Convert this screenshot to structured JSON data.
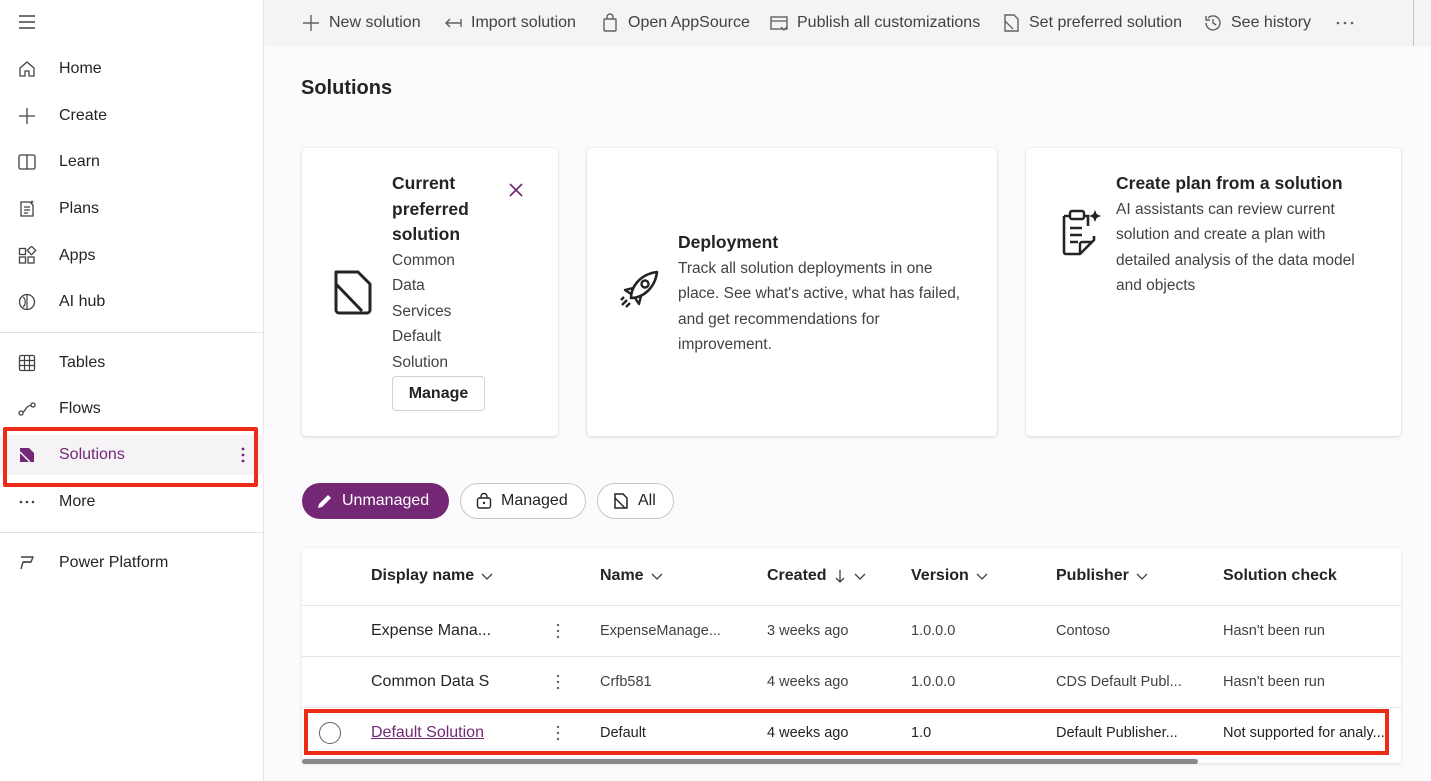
{
  "sidebar": {
    "items": [
      {
        "label": "Home",
        "icon": "home-icon"
      },
      {
        "label": "Create",
        "icon": "plus-icon"
      },
      {
        "label": "Learn",
        "icon": "book-icon"
      },
      {
        "label": "Plans",
        "icon": "plans-icon"
      },
      {
        "label": "Apps",
        "icon": "apps-icon"
      },
      {
        "label": "AI hub",
        "icon": "ai-hub-icon"
      },
      {
        "label": "Tables",
        "icon": "table-icon"
      },
      {
        "label": "Flows",
        "icon": "flows-icon"
      },
      {
        "label": "Solutions",
        "icon": "solutions-icon"
      },
      {
        "label": "More",
        "icon": "more-icon"
      },
      {
        "label": "Power Platform",
        "icon": "power-platform-icon"
      }
    ]
  },
  "commandbar": {
    "new_solution": "New solution",
    "import_solution": "Import solution",
    "open_appsource": "Open AppSource",
    "publish_all": "Publish all customizations",
    "set_preferred": "Set preferred solution",
    "see_history": "See history"
  },
  "page": {
    "title": "Solutions"
  },
  "cards": {
    "preferred": {
      "title_lines": [
        "Current",
        "preferred",
        "solution"
      ],
      "body_lines": [
        "Common",
        "Data",
        "Services",
        "Default",
        "Solution"
      ],
      "manage_label": "Manage"
    },
    "deployment": {
      "title": "Deployment",
      "body_lines": [
        "Track all solution deployments in one",
        "place. See what's active, what has failed,",
        "and get recommendations for",
        "improvement."
      ]
    },
    "plan": {
      "title": "Create plan from a solution",
      "body_lines": [
        "AI assistants can review current",
        "solution and create a plan with",
        "detailed analysis of the data model",
        "and objects"
      ]
    }
  },
  "filters": {
    "unmanaged": "Unmanaged",
    "managed": "Managed",
    "all": "All"
  },
  "table": {
    "headers": {
      "display_name": "Display name",
      "name": "Name",
      "created": "Created",
      "version": "Version",
      "publisher": "Publisher",
      "solution_check": "Solution check"
    },
    "rows": [
      {
        "display_name": "Expense Mana...",
        "name": "ExpenseManage...",
        "created": "3 weeks ago",
        "version": "1.0.0.0",
        "publisher": "Contoso",
        "solution_check": "Hasn't been run"
      },
      {
        "display_name": "Common Data S",
        "name": "Crfb581",
        "created": "4 weeks ago",
        "version": "1.0.0.0",
        "publisher": "CDS Default Publ...",
        "solution_check": "Hasn't been run"
      },
      {
        "display_name": "Default Solution",
        "name": "Default",
        "created": "4 weeks ago",
        "version": "1.0",
        "publisher": "Default Publisher...",
        "solution_check": "Not supported for analy..."
      }
    ]
  },
  "colors": {
    "accent": "#742774",
    "highlight": "#ee2b16"
  }
}
